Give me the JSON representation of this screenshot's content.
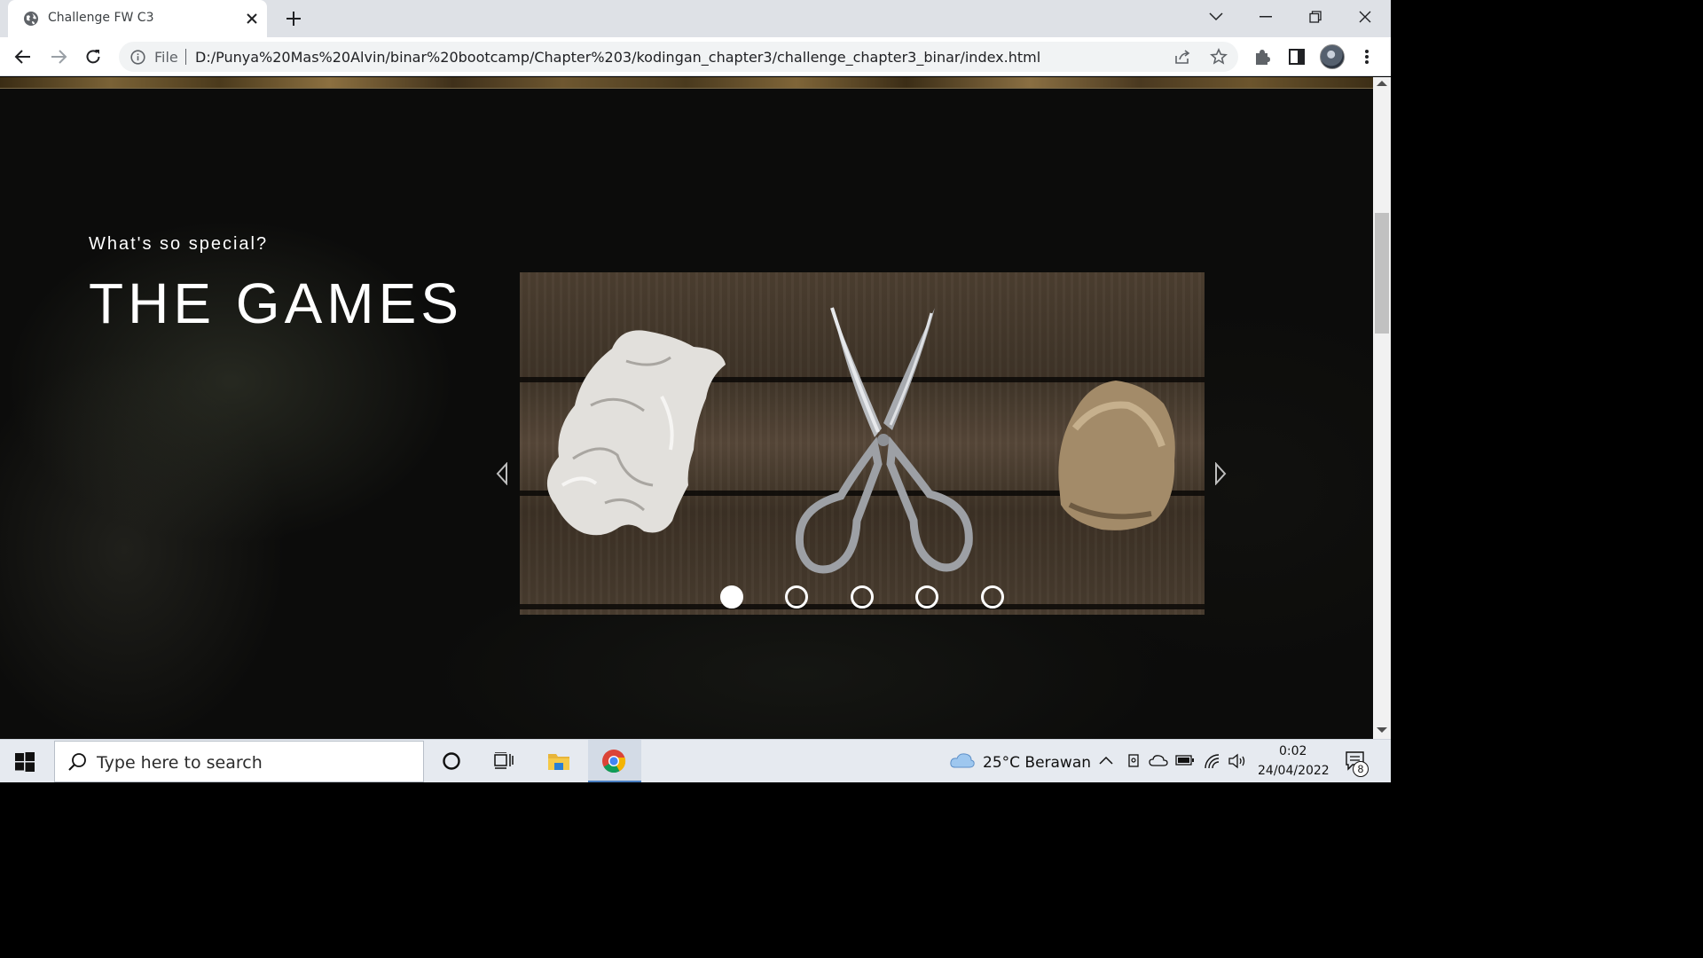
{
  "browser": {
    "tab_title": "Challenge FW C3",
    "url_scheme": "File",
    "url": "D:/Punya%20Mas%20Alvin/binar%20bootcamp/Chapter%203/kodingan_chapter3/challenge_chapter3_binar/index.html"
  },
  "page": {
    "subtitle": "What's so special?",
    "heading": "THE GAMES",
    "carousel": {
      "slide_count": 5,
      "active_index": 0,
      "image_description_icons": [
        "crumpled-paper",
        "scissors",
        "rock"
      ]
    }
  },
  "taskbar": {
    "search_placeholder": "Type here to search",
    "weather": "25°C  Berawan",
    "time": "0:02",
    "date": "24/04/2022",
    "notification_count": "8"
  }
}
